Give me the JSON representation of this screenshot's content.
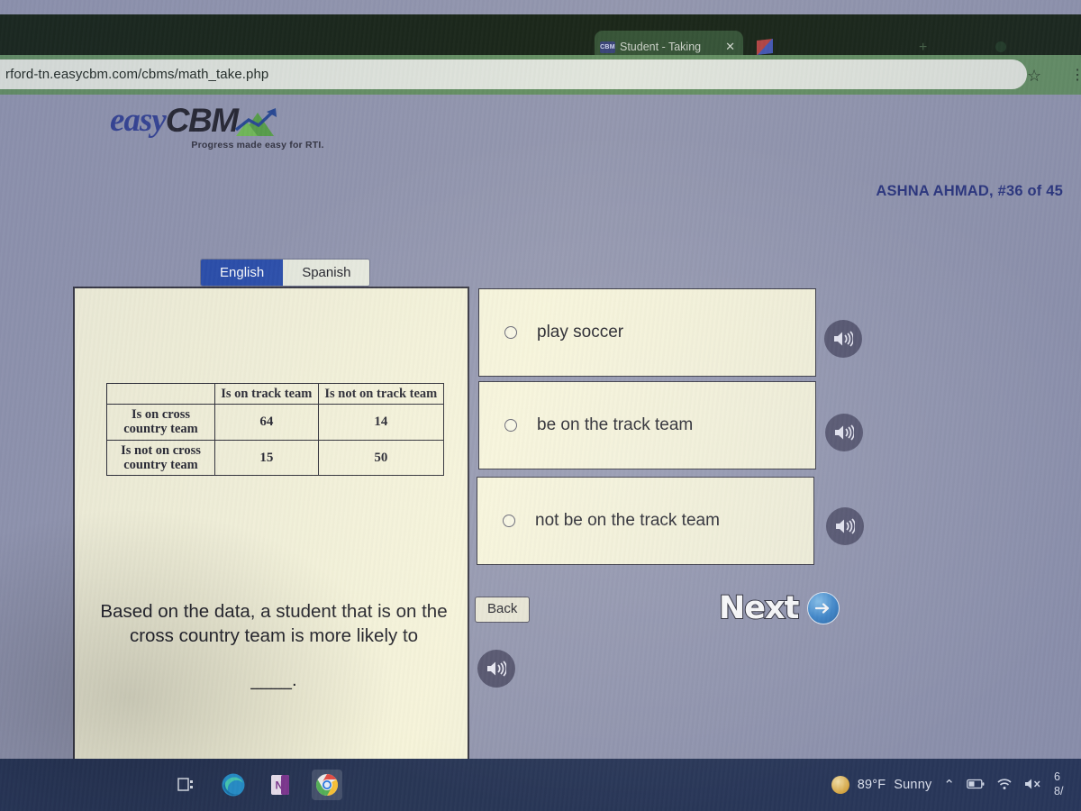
{
  "browser": {
    "tab": {
      "title": "Student - Taking",
      "favicon_label": "CBM",
      "close_icon": "✕"
    },
    "ghost_tabs": [
      "",
      ""
    ],
    "new_tab_icon": "+",
    "url": "rford-tn.easycbm.com/cbms/math_take.php",
    "star_icon": "☆",
    "menu_icon": "⋮"
  },
  "site": {
    "logo_easy": "easy",
    "logo_cbm": "CBM",
    "tagline": "Progress made easy for RTI.",
    "student_label": "ASHNA AHMAD, #36 of 45"
  },
  "language": {
    "tabs": [
      {
        "label": "English",
        "selected": true
      },
      {
        "label": "Spanish",
        "selected": false
      }
    ]
  },
  "question": {
    "prompt": "Based on the data, a student that is on the cross country team is more likely to",
    "blank": "____.",
    "speaker_icon": "speaker-icon",
    "table": {
      "corner": "",
      "col_headers": [
        "Is on track team",
        "Is not on track team"
      ],
      "rows": [
        {
          "header": "Is on cross country team",
          "values": [
            "64",
            "14"
          ]
        },
        {
          "header": "Is not on cross country team",
          "values": [
            "15",
            "50"
          ]
        }
      ]
    }
  },
  "options": [
    {
      "label": "play soccer",
      "selected": false,
      "speaker_icon": "speaker-icon"
    },
    {
      "label": "be on the track team",
      "selected": false,
      "speaker_icon": "speaker-icon"
    },
    {
      "label": "not be on the track team",
      "selected": false,
      "speaker_icon": "speaker-icon"
    }
  ],
  "nav": {
    "back_label": "Back",
    "next_label": "Next",
    "next_arrow_icon": "➔"
  },
  "taskbar": {
    "icons": [
      {
        "name": "task-view-icon",
        "glyph": "❏"
      },
      {
        "name": "edge-icon",
        "glyph": "e"
      },
      {
        "name": "onenote-icon",
        "glyph": "N"
      },
      {
        "name": "chrome-icon",
        "glyph": "◉"
      }
    ],
    "weather_temp": "89°F",
    "weather_desc": "Sunny",
    "chevron_icon": "⌃",
    "battery_icon": "▭",
    "wifi_icon": "◗",
    "volume_icon": "🔇",
    "clock_time": "6",
    "clock_date": "8/"
  },
  "colors": {
    "page_bg": "#8d91ac",
    "panel_bg": "#f5f3d9",
    "accent_blue": "#1f45a8",
    "taskbar_bg": "#1b2a4d",
    "toolbar_green": "#5d8a5c"
  }
}
